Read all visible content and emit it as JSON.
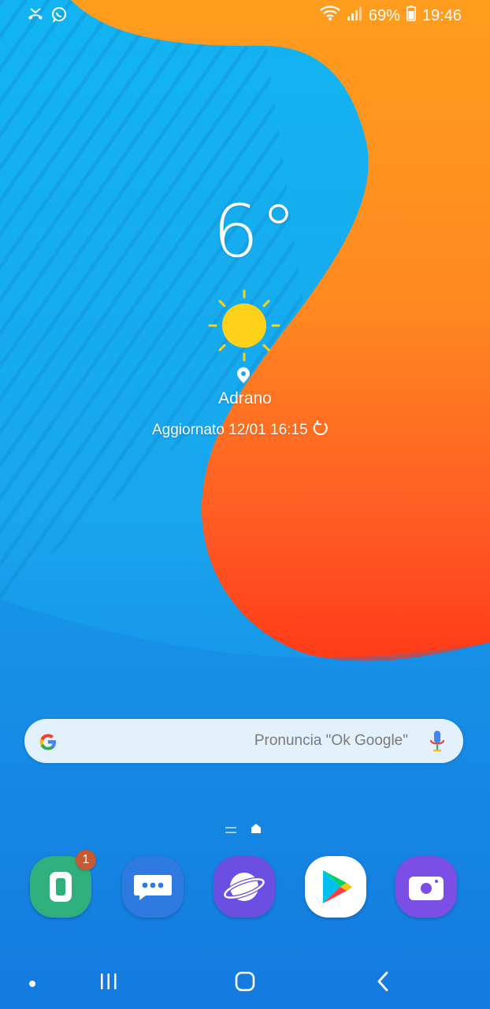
{
  "status_bar": {
    "battery_percent": "69%",
    "time": "19:46",
    "left_icons": [
      "missed-call-icon",
      "whatsapp-icon"
    ],
    "right_icons": [
      "wifi-icon",
      "signal-icon",
      "battery-icon"
    ]
  },
  "weather": {
    "temperature": "6°",
    "condition_icon": "sun-icon",
    "location": "Adrano",
    "updated": "Aggiornato 12/01 16:15"
  },
  "search": {
    "placeholder": "Pronuncia \"Ok Google\""
  },
  "dock": {
    "apps": [
      {
        "name": "phone",
        "icon": "phone-icon",
        "color": "#2fae7e",
        "badge": "1"
      },
      {
        "name": "messages",
        "icon": "messages-icon",
        "color": "#2f7ae0"
      },
      {
        "name": "internet",
        "icon": "internet-icon",
        "color": "#6a4fe0"
      },
      {
        "name": "play-store",
        "icon": "play-store-icon",
        "color": "#ffffff"
      },
      {
        "name": "screen-recorder",
        "icon": "camera-icon",
        "color": "#7b4fe6"
      }
    ]
  },
  "colors": {
    "wallpaper_blue": "#1aa7ec",
    "wallpaper_orange": "#ff8a1f",
    "wallpaper_red": "#ff4a1a",
    "sun": "#ffd21a"
  }
}
